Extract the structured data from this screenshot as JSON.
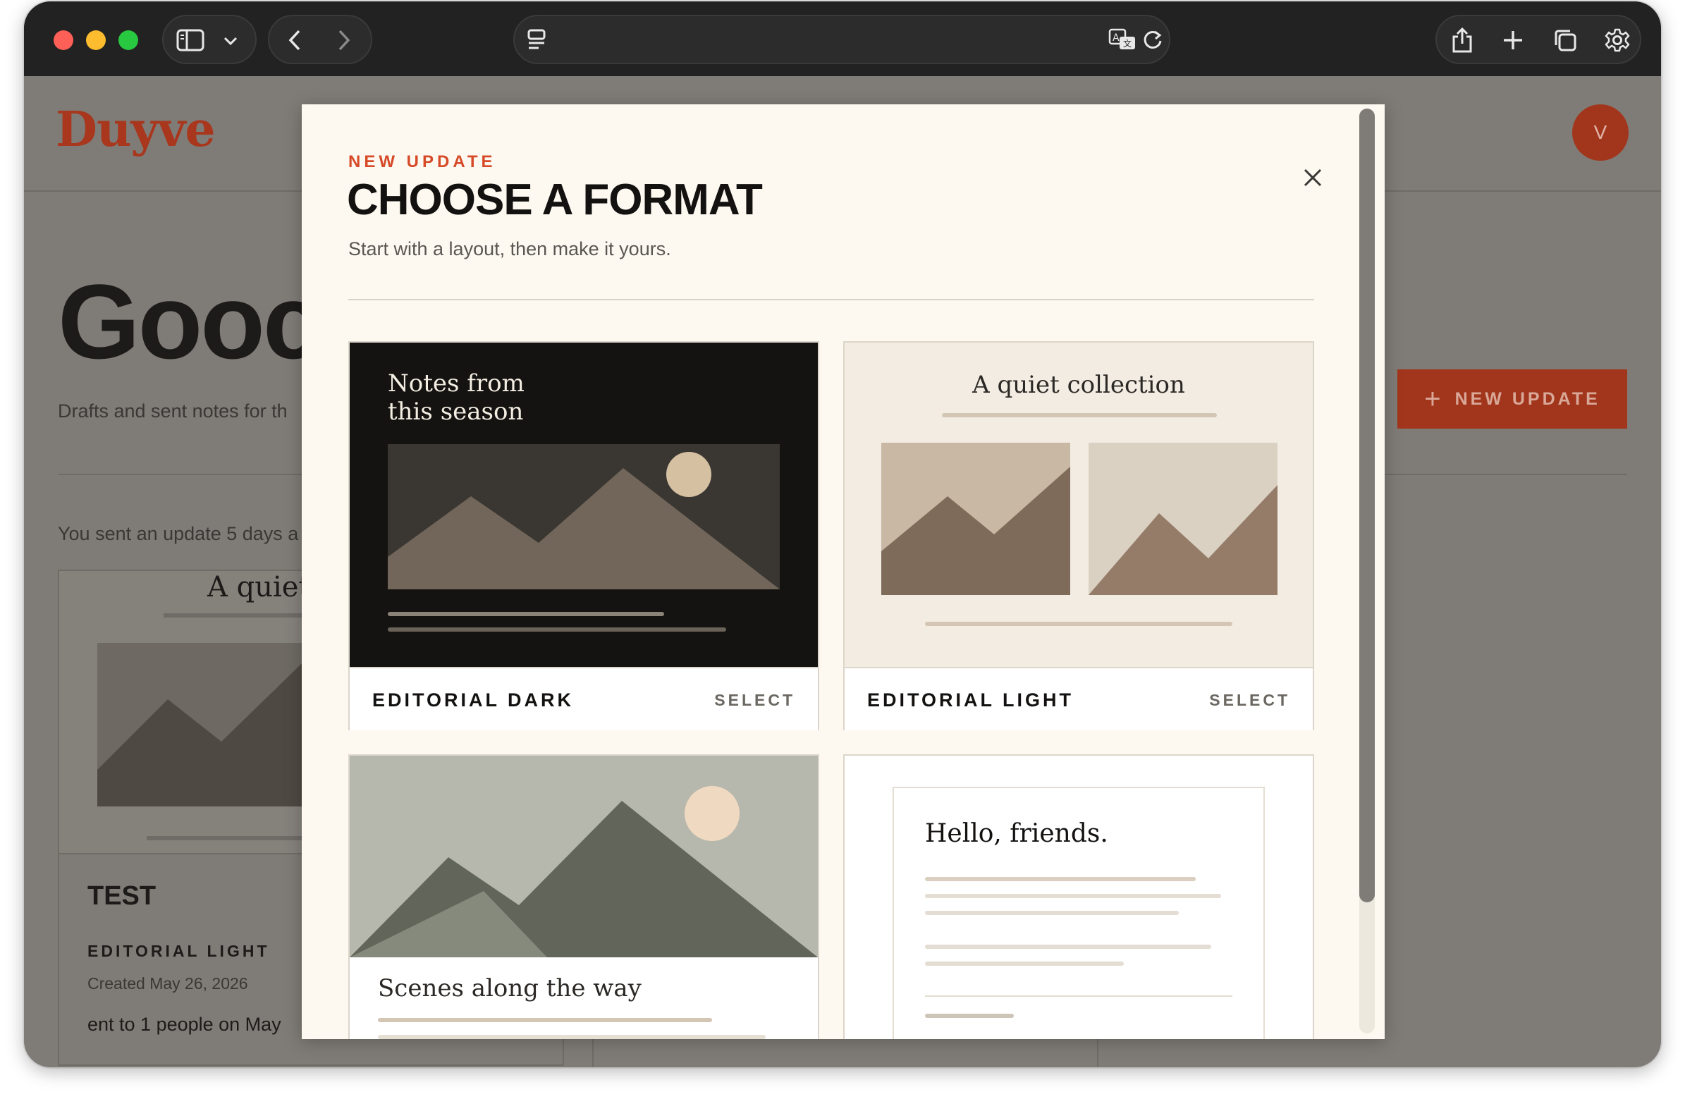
{
  "browser": {
    "toolbar_icons": [
      "sidebar-icon",
      "chevron-down-icon",
      "back-icon",
      "forward-icon",
      "reader-icon",
      "translate-icon",
      "reload-icon",
      "share-icon",
      "plus-icon",
      "tabs-icon",
      "gear-icon"
    ]
  },
  "app": {
    "logo": "Duyve",
    "avatar_initial": "V",
    "greeting": "Gooc",
    "drafts_text": "Drafts and sent notes for th",
    "sent_text": "You sent an update 5 days a",
    "new_update_button": "NEW UPDATE",
    "recent_card": {
      "thumb_title": "A quiet c",
      "title": "TEST",
      "format": "EDITORIAL LIGHT",
      "created": "Created May 26, 2026",
      "sent_to": "ent to 1 people on May"
    }
  },
  "modal": {
    "eyebrow": "NEW UPDATE",
    "title": "CHOOSE A FORMAT",
    "subtitle": "Start with a layout, then make it yours.",
    "select_label": "SELECT",
    "formats": [
      {
        "name": "EDITORIAL DARK",
        "preview_title_line1": "Notes from",
        "preview_title_line2": "this season"
      },
      {
        "name": "EDITORIAL LIGHT",
        "preview_title": "A quiet collection"
      },
      {
        "name": "",
        "preview_title": "Scenes along the way"
      },
      {
        "name": "",
        "preview_title": "Hello, friends."
      }
    ]
  },
  "colors": {
    "accent": "#d64a28",
    "brand": "#a8371d",
    "dark_card": "#151311",
    "modal_bg": "#fdf9f1"
  }
}
